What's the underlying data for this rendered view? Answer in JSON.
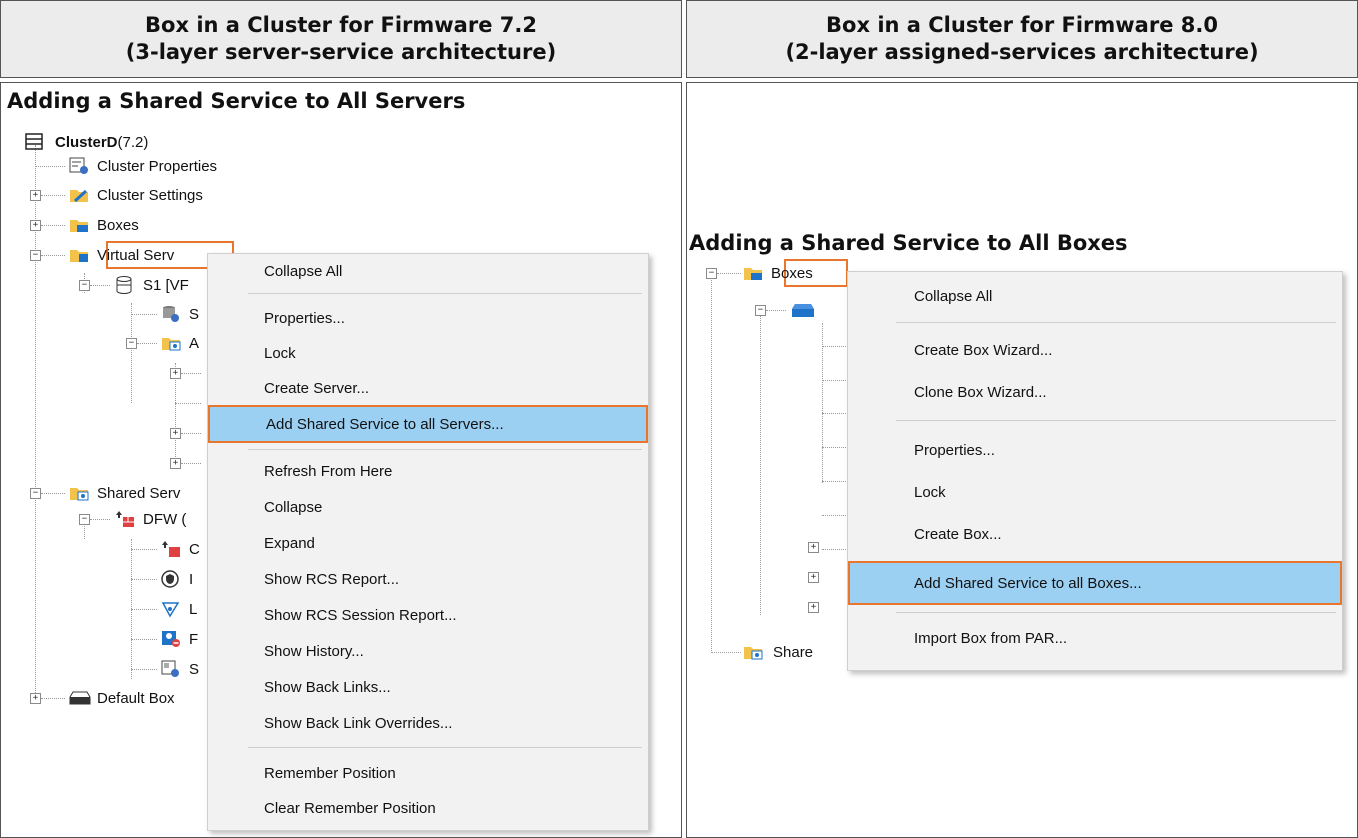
{
  "headers": {
    "left": {
      "line1": "Box in a Cluster for Firmware 7.2",
      "line2": "(3-layer server-service architecture)"
    },
    "right": {
      "line1": "Box in a Cluster for Firmware 8.0",
      "line2": "(2-layer assigned-services architecture)"
    }
  },
  "left": {
    "title": "Adding a Shared Service to All Servers",
    "tree": {
      "root_name": "ClusterD",
      "root_version": "(7.2)",
      "items": {
        "cluster_properties": "Cluster Properties",
        "cluster_settings": "Cluster Settings",
        "boxes": "Boxes",
        "virtual_servers": "Virtual Serv",
        "s1": "S1 [VF",
        "s1_child1": "S",
        "s1_child2": "A",
        "shared_services": "Shared Serv",
        "dfw": "DFW (",
        "dfw_c1": "C",
        "dfw_c2": "I",
        "dfw_c3": "L",
        "dfw_c4": "F",
        "dfw_c5": "S",
        "default_box": "Default Box"
      }
    },
    "menu": [
      "Collapse All",
      "Properties...",
      "Lock",
      "Create Server...",
      "Add Shared Service to all Servers...",
      "Refresh From Here",
      "Collapse",
      "Expand",
      "Show RCS Report...",
      "Show RCS Session Report...",
      "Show History...",
      "Show Back Links...",
      "Show Back Link Overrides...",
      "Remember Position",
      "Clear Remember Position"
    ]
  },
  "right": {
    "title": "Adding a Shared Service to All Boxes",
    "tree": {
      "boxes": "Boxes",
      "shared": "Share"
    },
    "menu": [
      "Collapse All",
      "Create Box Wizard...",
      "Clone Box Wizard...",
      "Properties...",
      "Lock",
      "Create Box...",
      "Add Shared Service to all Boxes...",
      "Import Box from PAR..."
    ]
  },
  "colors": {
    "highlight_fill": "#9cd0f3",
    "highlight_border": "#e8772d",
    "folder_yellow": "#f3c24a",
    "icon_blue": "#1e73c8"
  }
}
